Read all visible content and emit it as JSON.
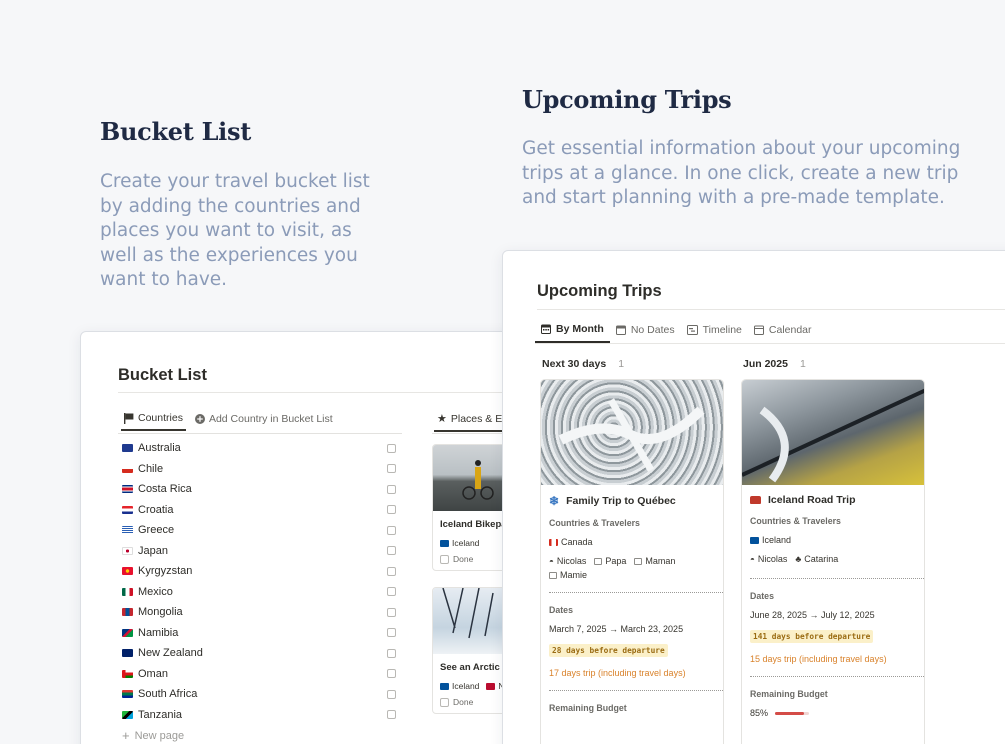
{
  "hero_left": {
    "title": "Bucket List",
    "text": "Create your travel bucket list by adding the countries and places you want to visit, as well as the experiences you want to have."
  },
  "hero_right": {
    "title": "Upcoming Trips",
    "text": "Get essential information about your upcoming trips at a glance. In one click, create a new trip and start planning with a pre-made template."
  },
  "bucket_list": {
    "title": "Bucket List",
    "tab_countries": "Countries",
    "tab_add_country": "Add Country in Bucket List",
    "tab_places": "Places & Ex",
    "countries": [
      "Australia",
      "Chile",
      "Costa Rica",
      "Croatia",
      "Greece",
      "Japan",
      "Kyrgyzstan",
      "Mexico",
      "Mongolia",
      "Namibia",
      "New Zealand",
      "Oman",
      "South Africa",
      "Tanzania"
    ],
    "new_page": "New page",
    "cards": [
      {
        "title": "Iceland Bikepa",
        "tag": "Iceland",
        "tag2": "",
        "status": "Done"
      },
      {
        "title": "See an Arctic F",
        "tag": "Iceland",
        "tag2": "N",
        "status": "Done"
      }
    ]
  },
  "upcoming": {
    "title": "Upcoming Trips",
    "tabs": [
      "By Month",
      "No Dates",
      "Timeline",
      "Calendar"
    ],
    "groups": [
      {
        "name": "Next 30 days",
        "count": "1"
      },
      {
        "name": "Jun 2025",
        "count": "1"
      }
    ],
    "trips": [
      {
        "name": "Family Trip to Québec",
        "countries_label": "Countries & Travelers",
        "country": "Canada",
        "travelers": [
          "Nicolas",
          "Papa",
          "Maman",
          "Mamie"
        ],
        "dates_label": "Dates",
        "dates": "March 7, 2025 → March 23, 2025",
        "badge": "28 days before departure",
        "duration": "17 days trip (including travel days)",
        "budget_label": "Remaining Budget",
        "budget": ""
      },
      {
        "name": "Iceland Road Trip",
        "countries_label": "Countries & Travelers",
        "country": "Iceland",
        "travelers": [
          "Nicolas",
          "Catarina"
        ],
        "dates_label": "Dates",
        "dates": "June 28, 2025 → July 12, 2025",
        "badge": "141 days before departure",
        "duration": "15 days trip (including travel days)",
        "budget_label": "Remaining Budget",
        "budget": "85%"
      }
    ]
  },
  "colors": {
    "accent_red": "#d44c47",
    "badge_bg": "#fbf0c9",
    "hero_text": "#8b9bb8"
  }
}
